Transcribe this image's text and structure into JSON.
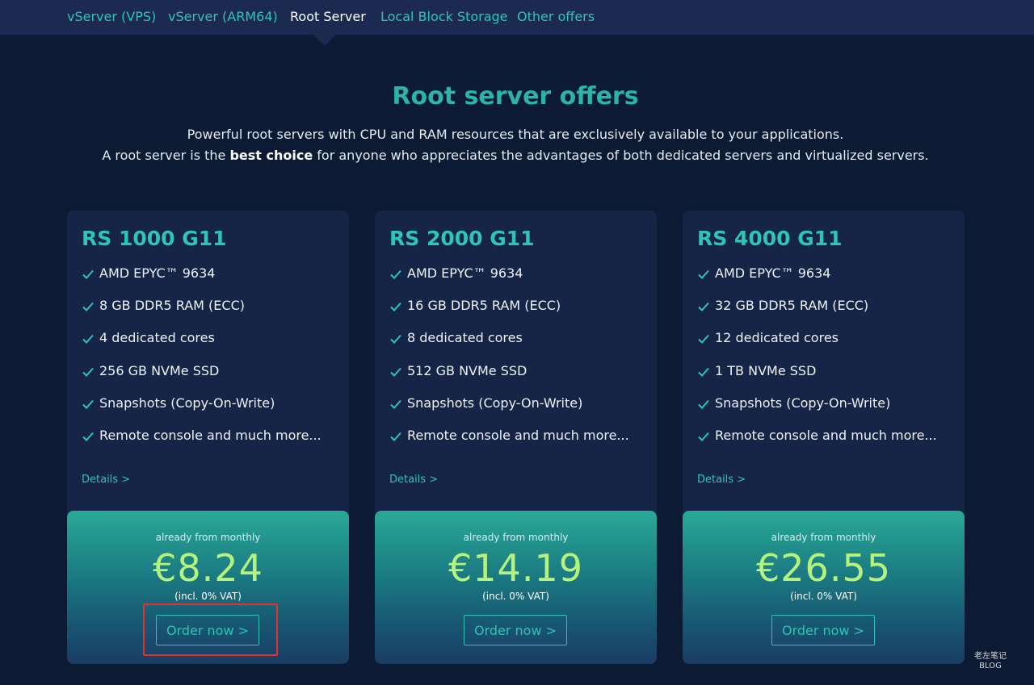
{
  "nav": {
    "items": [
      {
        "label": "vServer (VPS)",
        "active": false
      },
      {
        "label": "vServer (ARM64)",
        "active": false
      },
      {
        "label": "Root Server",
        "active": true
      },
      {
        "label": "Local Block Storage",
        "active": false
      },
      {
        "label": "Other offers",
        "active": false
      }
    ]
  },
  "page": {
    "title": "Root server offers",
    "intro_line1": "Powerful root servers with CPU and RAM resources that are exclusively available to your applications.",
    "intro_line2_prefix": "A root server is the ",
    "intro_line2_bold": "best choice",
    "intro_line2_suffix": " for anyone who appreciates the advantages of both dedicated servers and virtualized servers."
  },
  "cards": [
    {
      "title": "RS 1000 G11",
      "features": [
        "AMD EPYC™ 9634",
        "8 GB DDR5 RAM (ECC)",
        "4 dedicated cores",
        "256 GB NVMe SSD",
        "Snapshots (Copy-On-Write)",
        "Remote console and much more..."
      ],
      "details_label": "Details >",
      "price_label": "already from monthly",
      "price": "€8.24",
      "vat": "(incl. 0% VAT)",
      "order_label": "Order now >"
    },
    {
      "title": "RS 2000 G11",
      "features": [
        "AMD EPYC™ 9634",
        "16 GB DDR5 RAM (ECC)",
        "8 dedicated cores",
        "512 GB NVMe SSD",
        "Snapshots (Copy-On-Write)",
        "Remote console and much more..."
      ],
      "details_label": "Details >",
      "price_label": "already from monthly",
      "price": "€14.19",
      "vat": "(incl. 0% VAT)",
      "order_label": "Order now >"
    },
    {
      "title": "RS 4000 G11",
      "features": [
        "AMD EPYC™ 9634",
        "32 GB DDR5 RAM (ECC)",
        "12 dedicated cores",
        "1 TB NVMe SSD",
        "Snapshots (Copy-On-Write)",
        "Remote console and much more..."
      ],
      "details_label": "Details >",
      "price_label": "already from monthly",
      "price": "€26.55",
      "vat": "(incl. 0% VAT)",
      "order_label": "Order now >"
    }
  ],
  "watermark": {
    "line1": "老左笔记",
    "line2": "BLOG"
  },
  "colors": {
    "background": "#0d1a33",
    "nav_bg": "#1c2a52",
    "accent": "#2ec4b6",
    "price": "#b6f27e",
    "highlight": "#e5312b"
  },
  "icons": {
    "feature": "check-icon"
  }
}
